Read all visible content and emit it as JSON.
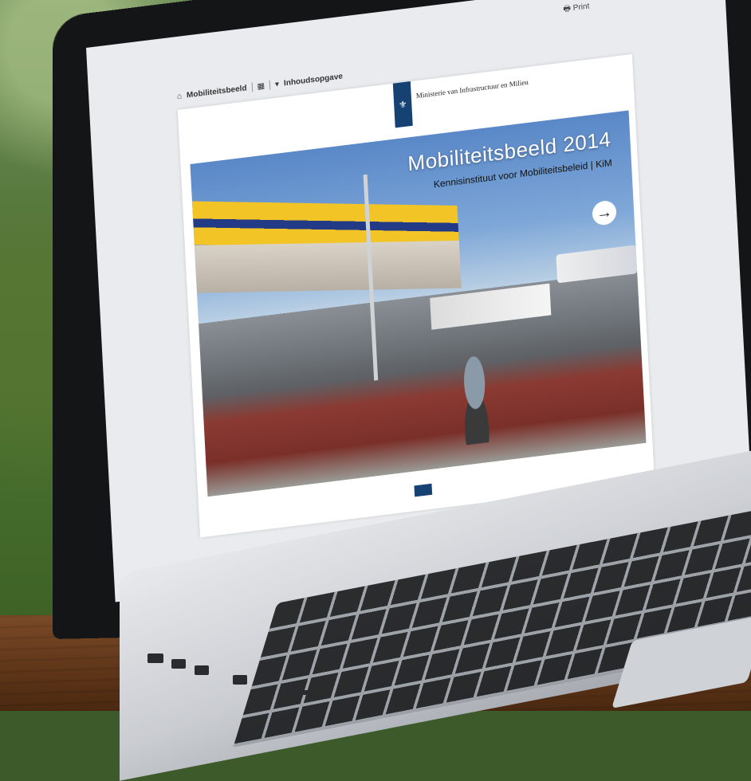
{
  "topbar": {
    "home_label": "Mobiliteitsbeeld",
    "grid_icon": "grid-icon",
    "toc_label": "Inhoudsopgave",
    "print_label": "Print"
  },
  "header": {
    "ministry": "Ministerie van Infrastructuur en Milieu"
  },
  "hero": {
    "title": "Mobiliteitsbeeld 2014",
    "subtitle": "Kennisinstituut voor Mobiliteitsbeleid | KiM"
  },
  "colors": {
    "brand": "#154273"
  }
}
